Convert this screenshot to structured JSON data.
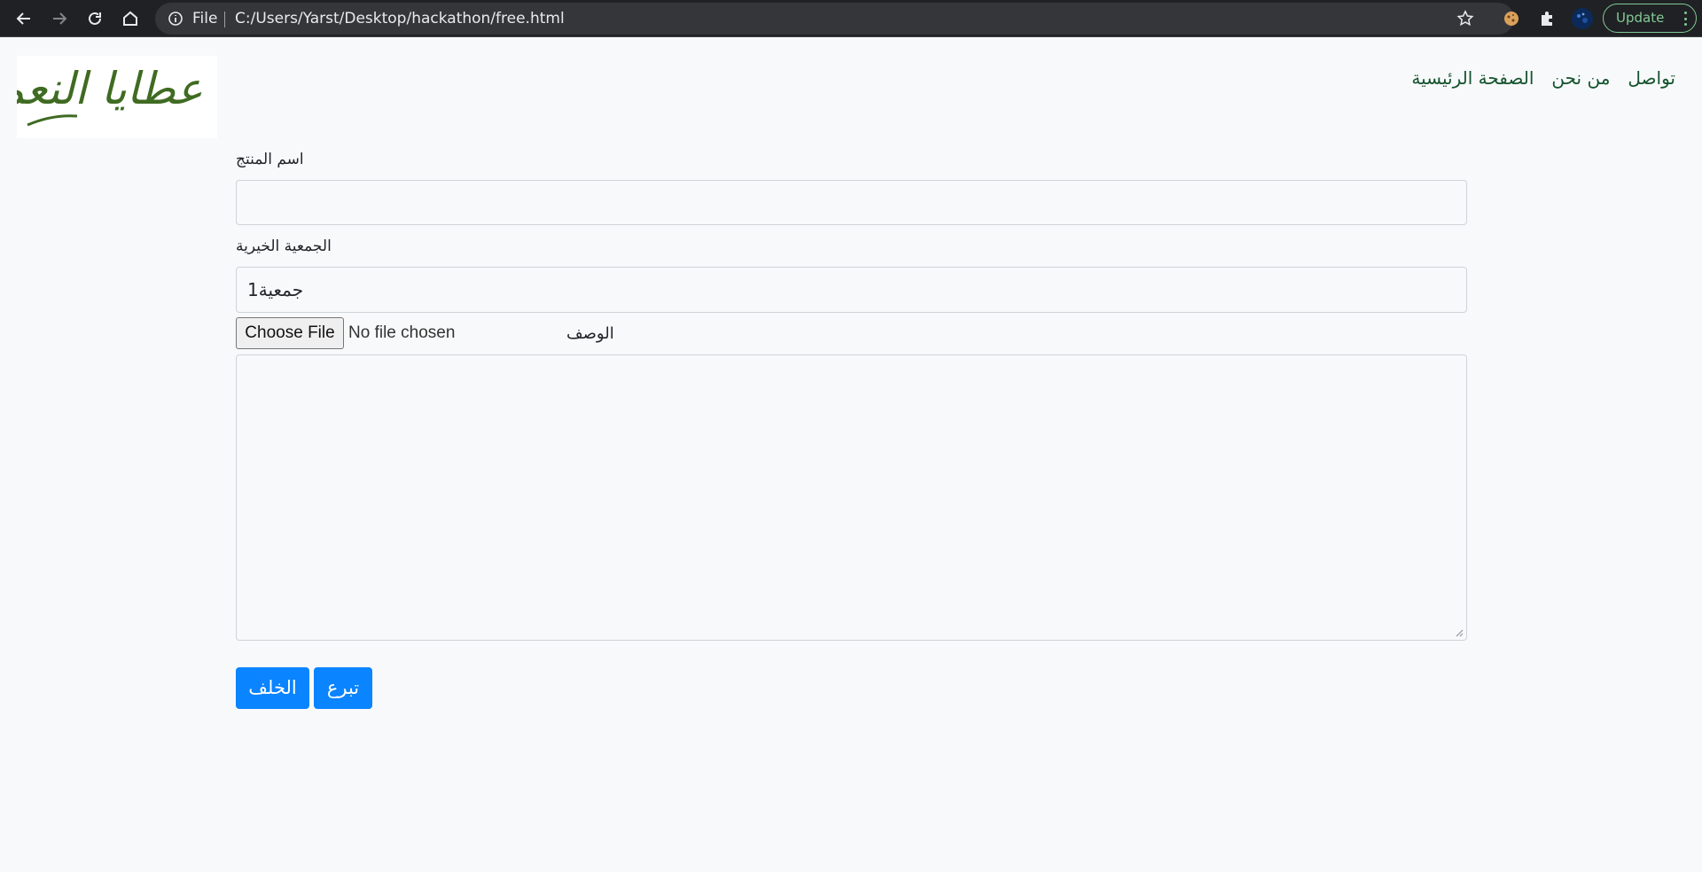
{
  "browser": {
    "file_label": "File",
    "url": "C:/Users/Yarst/Desktop/hackathon/free.html",
    "update_label": "Update"
  },
  "header": {
    "logo_text": "عطايا النعم",
    "nav": [
      {
        "label": "تواصل"
      },
      {
        "label": "من نحن"
      },
      {
        "label": "الصفحة الرئيسية"
      }
    ]
  },
  "form": {
    "product_name_label": "اسم المنتج",
    "product_name_value": "",
    "charity_label": "الجمعية الخيرية",
    "charity_value": "جمعية1",
    "file_button": "Choose File",
    "file_status": "No file chosen",
    "description_label": "الوصف",
    "description_value": "",
    "back_button": "الخلف",
    "donate_button": "تبرع"
  },
  "colors": {
    "nav_link": "#14532d",
    "primary": "#0a84ff",
    "logo": "#3f6b22"
  }
}
